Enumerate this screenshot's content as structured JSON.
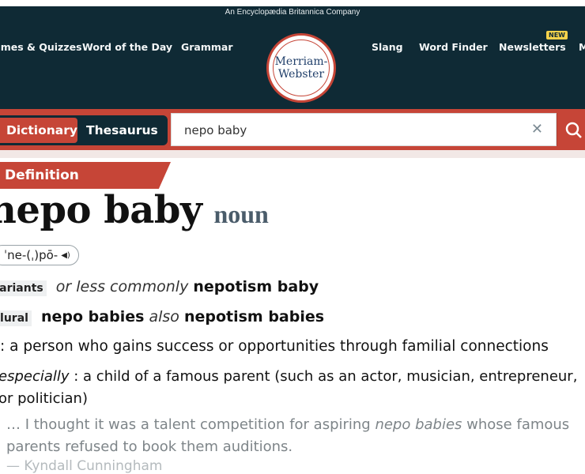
{
  "header": {
    "tagline": "An Encyclopædia Britannica Company",
    "nav_left": [
      "Games & Quizzes",
      "Word of the Day",
      "Grammar"
    ],
    "nav_right": [
      "Slang",
      "Word Finder",
      "Newsletters",
      "More"
    ],
    "new_badge": "NEW",
    "logo_line1": "Merriam-",
    "logo_line2": "Webster"
  },
  "search": {
    "tab_dictionary": "Dictionary",
    "tab_thesaurus": "Thesaurus",
    "query": "nepo baby",
    "clear_icon": "close-icon",
    "search_icon": "search-icon"
  },
  "entry": {
    "section_label": "Definition",
    "headword": "nepo baby",
    "part_of_speech": "noun",
    "pronunciation": "ˈne-(ˌ)pō-",
    "variants_label": "variants",
    "variants_qualifier": "or less commonly",
    "variant_form": "nepotism baby",
    "plural_label": "plural",
    "plural_form": "nepo babies",
    "plural_also": "also",
    "plural_alt": "nepotism babies",
    "sense1": ": a person who gains success or opportunities through familial connections",
    "sense2_label": "especially",
    "sense2_text": " : a child of a famous parent (such as an actor, musician, entrepreneur, or politician)",
    "quote_start": "… I thought it was a talent competition for aspiring ",
    "quote_italic": "nepo babies",
    "quote_end": " whose famous parents refused to book them auditions.",
    "attribution": "— Kyndall Cunningham"
  },
  "colors": {
    "header_bg": "#0f2a35",
    "brand_red": "#c64537",
    "logo_text": "#203f6a"
  }
}
